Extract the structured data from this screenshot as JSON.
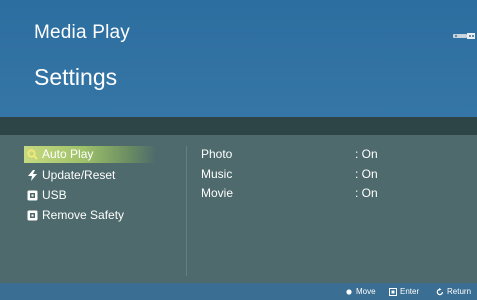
{
  "header": {
    "app_title": "Media Play",
    "page_title": "Settings",
    "device_icon": "usb-icon"
  },
  "menu": {
    "items": [
      {
        "label": "Auto Play",
        "icon": "magnifier-icon",
        "selected": true
      },
      {
        "label": "Update/Reset",
        "icon": "bolt-icon",
        "selected": false
      },
      {
        "label": "USB",
        "icon": "usb-device-icon",
        "selected": false
      },
      {
        "label": "Remove Safety",
        "icon": "usb-device-icon",
        "selected": false
      }
    ]
  },
  "settings": {
    "rows": [
      {
        "name": "Photo",
        "value": ": On"
      },
      {
        "name": "Music",
        "value": ": On"
      },
      {
        "name": "Movie",
        "value": ": On"
      }
    ]
  },
  "footer": {
    "hints": [
      {
        "label": "Move",
        "icon": "dot-icon"
      },
      {
        "label": "Enter",
        "icon": "enter-icon"
      },
      {
        "label": "Return",
        "icon": "return-icon"
      }
    ]
  },
  "colors": {
    "header_bg": "#2c6e9f",
    "content_bg": "#4e6a6c",
    "footer_bg": "#3a6e92",
    "selection": "#9ec16a"
  }
}
